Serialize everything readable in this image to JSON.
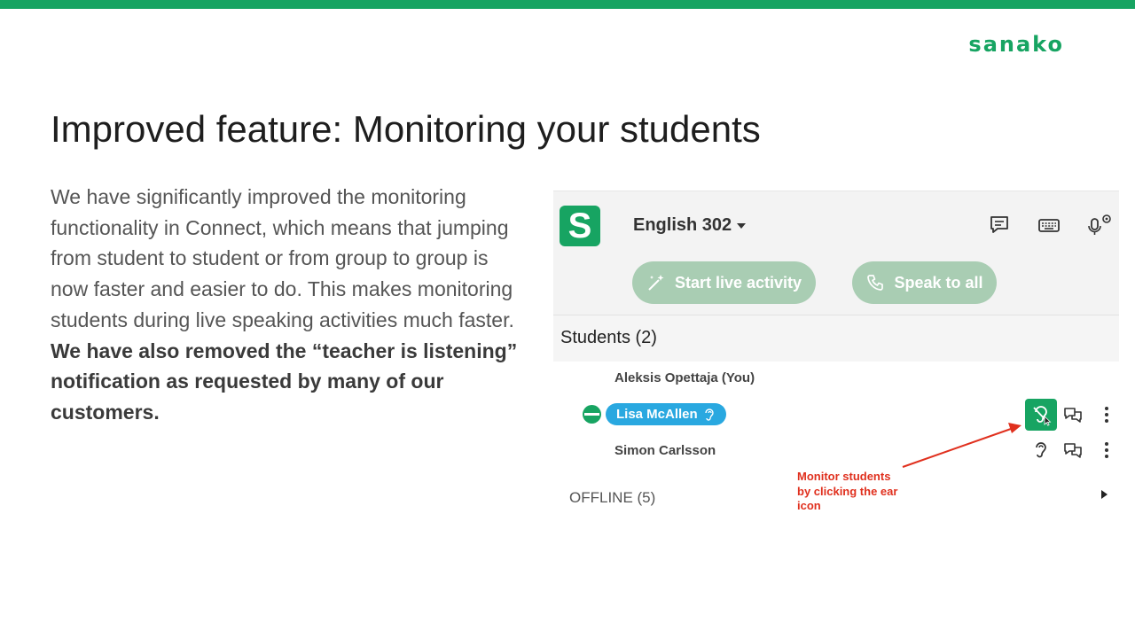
{
  "slide": {
    "brand": "sanako",
    "title": "Improved feature: Monitoring your students",
    "body_normal": "We have significantly improved the monitoring functionality in Connect, which means that jumping from student to student or from group to group is now faster and easier to do. This makes monitoring students during live speaking activities much faster. ",
    "body_bold": "We have also removed the “teacher is listening” notification as requested by many of our customers."
  },
  "app": {
    "logo_letter": "S",
    "course_name": "English 302",
    "toolbar_icons": [
      "chat-icon",
      "keyboard-icon",
      "mic-settings-icon"
    ],
    "start_live_label": "Start live activity",
    "speak_all_label": "Speak to all",
    "students_label": "Students (2)",
    "teacher_name": "Aleksis Opettaja (You)",
    "students": [
      {
        "name": "Lisa McAllen",
        "status": "online",
        "monitoring": true
      },
      {
        "name": "Simon Carlsson",
        "monitoring": false
      }
    ],
    "offline_label": "OFFLINE (5)"
  },
  "annotation": {
    "text_lines": [
      "Monitor students",
      "by clicking the ear",
      "icon"
    ],
    "color": "#e0301e"
  },
  "colors": {
    "brand_green": "#17a462",
    "pill_disabled": "#a9cdb3",
    "highlight_blue": "#29a8e0"
  }
}
